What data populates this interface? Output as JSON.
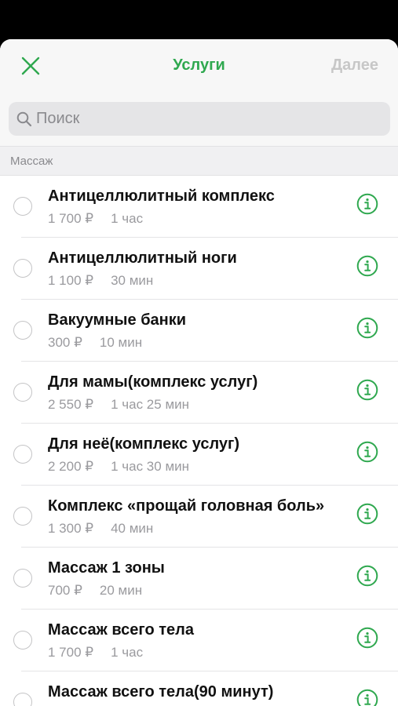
{
  "header": {
    "title": "Услуги",
    "next_label": "Далее",
    "close_icon": "close-icon"
  },
  "search": {
    "placeholder": "Поиск",
    "value": ""
  },
  "section": {
    "title": "Массаж"
  },
  "colors": {
    "accent": "#2fa84f",
    "disabled": "#c7c7c7",
    "muted": "#9a9a9e"
  },
  "services": [
    {
      "name": "Антицеллюлитный комплекс",
      "price": "1 700 ₽",
      "duration": "1 час"
    },
    {
      "name": "Антицеллюлитный ноги",
      "price": "1 100 ₽",
      "duration": "30 мин"
    },
    {
      "name": "Вакуумные банки",
      "price": "300 ₽",
      "duration": "10 мин"
    },
    {
      "name": "Для мамы(комплекс услуг)",
      "price": "2 550 ₽",
      "duration": "1 час 25 мин"
    },
    {
      "name": "Для неё(комплекс услуг)",
      "price": "2 200 ₽",
      "duration": "1 час 30 мин"
    },
    {
      "name": "Комплекс «прощай головная боль»",
      "price": "1 300 ₽",
      "duration": "40 мин"
    },
    {
      "name": "Массаж 1 зоны",
      "price": "700 ₽",
      "duration": "20 мин"
    },
    {
      "name": "Массаж всего тела",
      "price": "1 700 ₽",
      "duration": "1 час"
    },
    {
      "name": "Массаж всего тела(90 минут)",
      "price": "",
      "duration": ""
    }
  ]
}
